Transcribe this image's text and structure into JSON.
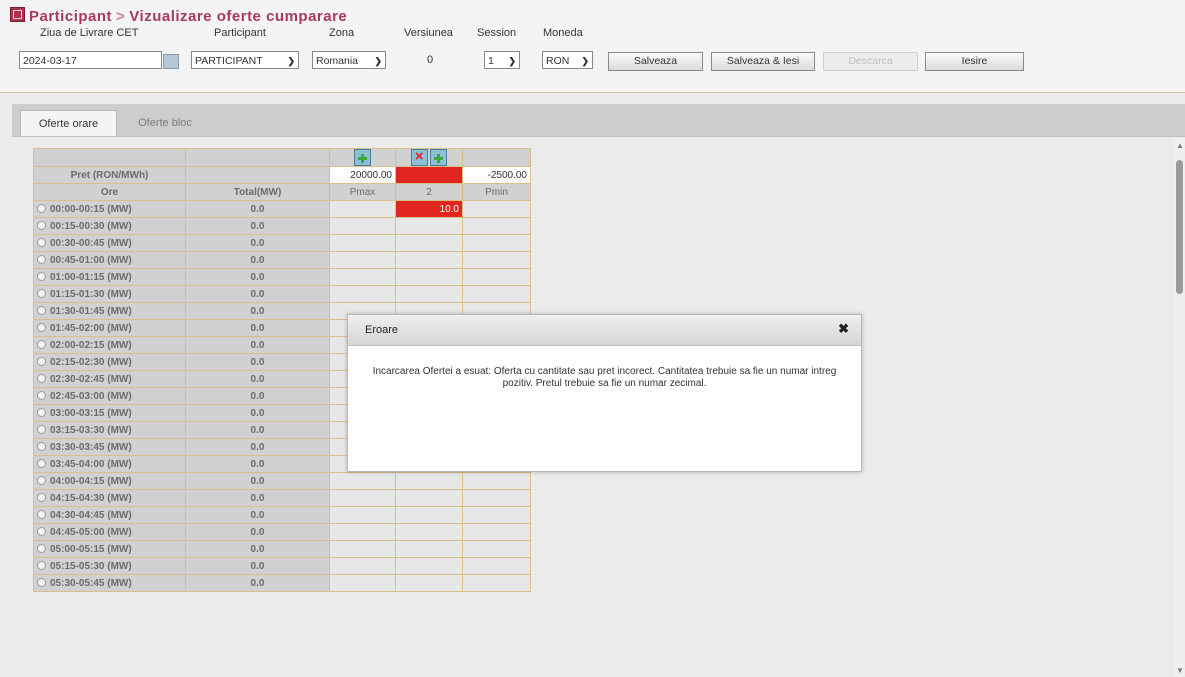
{
  "header": {
    "title_part1": "Participant",
    "title_sep": ">",
    "title_part2": "Vizualizare oferte cumparare"
  },
  "filters": {
    "delivery_day_label": "Ziua de Livrare CET",
    "delivery_day_value": "2024-03-17",
    "participant_label": "Participant",
    "participant_value": "PARTICIPANT",
    "zone_label": "Zona",
    "zone_value": "Romania",
    "version_label": "Versiunea",
    "version_value": "0",
    "session_label": "Session",
    "session_value": "1",
    "currency_label": "Moneda",
    "currency_value": "RON"
  },
  "buttons": {
    "save": "Salveaza",
    "save_exit": "Salveaza & Iesi",
    "download": "Descarca",
    "exit": "Iesire"
  },
  "tabs": {
    "hourly": "Oferte orare",
    "block": "Oferte bloc"
  },
  "grid": {
    "price_label": "Pret (RON/MWh)",
    "price_pmax": "20000.00",
    "price_col2": "",
    "price_pmin": "-2500.00",
    "hours_header": "Ore",
    "total_header": "Total(MW)",
    "col_pmax": "Pmax",
    "col_2": "2",
    "col_pmin": "Pmin",
    "first_row_col2": "10.0",
    "rows": [
      {
        "interval": "00:00-00:15 (MW)",
        "total": "0.0"
      },
      {
        "interval": "00:15-00:30 (MW)",
        "total": "0.0"
      },
      {
        "interval": "00:30-00:45 (MW)",
        "total": "0.0"
      },
      {
        "interval": "00:45-01:00 (MW)",
        "total": "0.0"
      },
      {
        "interval": "01:00-01:15 (MW)",
        "total": "0.0"
      },
      {
        "interval": "01:15-01:30 (MW)",
        "total": "0.0"
      },
      {
        "interval": "01:30-01:45 (MW)",
        "total": "0.0"
      },
      {
        "interval": "01:45-02:00 (MW)",
        "total": "0.0"
      },
      {
        "interval": "02:00-02:15 (MW)",
        "total": "0.0"
      },
      {
        "interval": "02:15-02:30 (MW)",
        "total": "0.0"
      },
      {
        "interval": "02:30-02:45 (MW)",
        "total": "0.0"
      },
      {
        "interval": "02:45-03:00 (MW)",
        "total": "0.0"
      },
      {
        "interval": "03:00-03:15 (MW)",
        "total": "0.0"
      },
      {
        "interval": "03:15-03:30 (MW)",
        "total": "0.0"
      },
      {
        "interval": "03:30-03:45 (MW)",
        "total": "0.0"
      },
      {
        "interval": "03:45-04:00 (MW)",
        "total": "0.0"
      },
      {
        "interval": "04:00-04:15 (MW)",
        "total": "0.0"
      },
      {
        "interval": "04:15-04:30 (MW)",
        "total": "0.0"
      },
      {
        "interval": "04:30-04:45 (MW)",
        "total": "0.0"
      },
      {
        "interval": "04:45-05:00 (MW)",
        "total": "0.0"
      },
      {
        "interval": "05:00-05:15 (MW)",
        "total": "0.0"
      },
      {
        "interval": "05:15-05:30 (MW)",
        "total": "0.0"
      },
      {
        "interval": "05:30-05:45 (MW)",
        "total": "0.0"
      }
    ]
  },
  "dialog": {
    "title": "Eroare",
    "close": "✖",
    "message": "Incarcarea Ofertei a esuat: Oferta cu cantitate sau pret incorect. Cantitatea trebuie sa fie un numar intreg pozitiv. Pretul trebuie sa fie un numar zecimal."
  },
  "icons": {
    "add_column": "add-column-icon",
    "delete_column": "delete-column-icon",
    "calendar": "calendar-icon",
    "close": "close-icon"
  },
  "colors": {
    "title": "#a83a5e",
    "error_cell": "#e0261e",
    "grid_border": "#d7c08a"
  }
}
